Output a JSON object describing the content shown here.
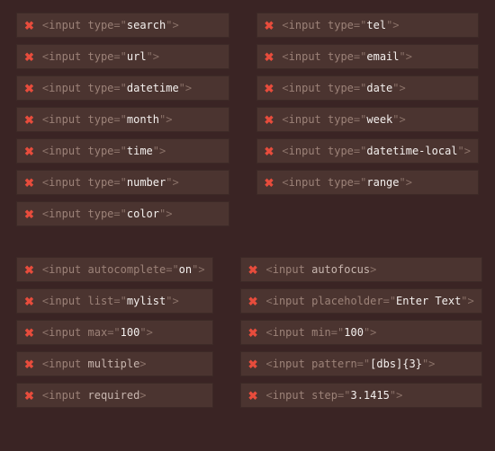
{
  "sections": [
    {
      "rows": [
        {
          "pass": false,
          "element": "input",
          "attr": "type",
          "value": "search"
        },
        {
          "pass": false,
          "element": "input",
          "attr": "type",
          "value": "tel"
        },
        {
          "pass": false,
          "element": "input",
          "attr": "type",
          "value": "url"
        },
        {
          "pass": false,
          "element": "input",
          "attr": "type",
          "value": "email"
        },
        {
          "pass": false,
          "element": "input",
          "attr": "type",
          "value": "datetime"
        },
        {
          "pass": false,
          "element": "input",
          "attr": "type",
          "value": "date"
        },
        {
          "pass": false,
          "element": "input",
          "attr": "type",
          "value": "month"
        },
        {
          "pass": false,
          "element": "input",
          "attr": "type",
          "value": "week"
        },
        {
          "pass": false,
          "element": "input",
          "attr": "type",
          "value": "time"
        },
        {
          "pass": false,
          "element": "input",
          "attr": "type",
          "value": "datetime-local"
        },
        {
          "pass": false,
          "element": "input",
          "attr": "type",
          "value": "number"
        },
        {
          "pass": false,
          "element": "input",
          "attr": "type",
          "value": "range"
        },
        {
          "pass": false,
          "element": "input",
          "attr": "type",
          "value": "color"
        },
        null
      ]
    },
    {
      "rows": [
        {
          "pass": false,
          "element": "input",
          "attr": "autocomplete",
          "value": "on"
        },
        {
          "pass": false,
          "element": "input",
          "attr": "autofocus"
        },
        {
          "pass": false,
          "element": "input",
          "attr": "list",
          "value": "mylist"
        },
        {
          "pass": false,
          "element": "input",
          "attr": "placeholder",
          "value": "Enter Text"
        },
        {
          "pass": false,
          "element": "input",
          "attr": "max",
          "value": "100"
        },
        {
          "pass": false,
          "element": "input",
          "attr": "min",
          "value": "100"
        },
        {
          "pass": false,
          "element": "input",
          "attr": "multiple"
        },
        {
          "pass": false,
          "element": "input",
          "attr": "pattern",
          "value": "[dbs]{3}"
        },
        {
          "pass": false,
          "element": "input",
          "attr": "required"
        },
        {
          "pass": false,
          "element": "input",
          "attr": "step",
          "value": "3.1415"
        }
      ]
    }
  ],
  "glyphs": {
    "fail": "✖",
    "pass": "✔"
  },
  "syntax": {
    "open": "<",
    "close": ">",
    "eq": "=",
    "q": "\""
  }
}
